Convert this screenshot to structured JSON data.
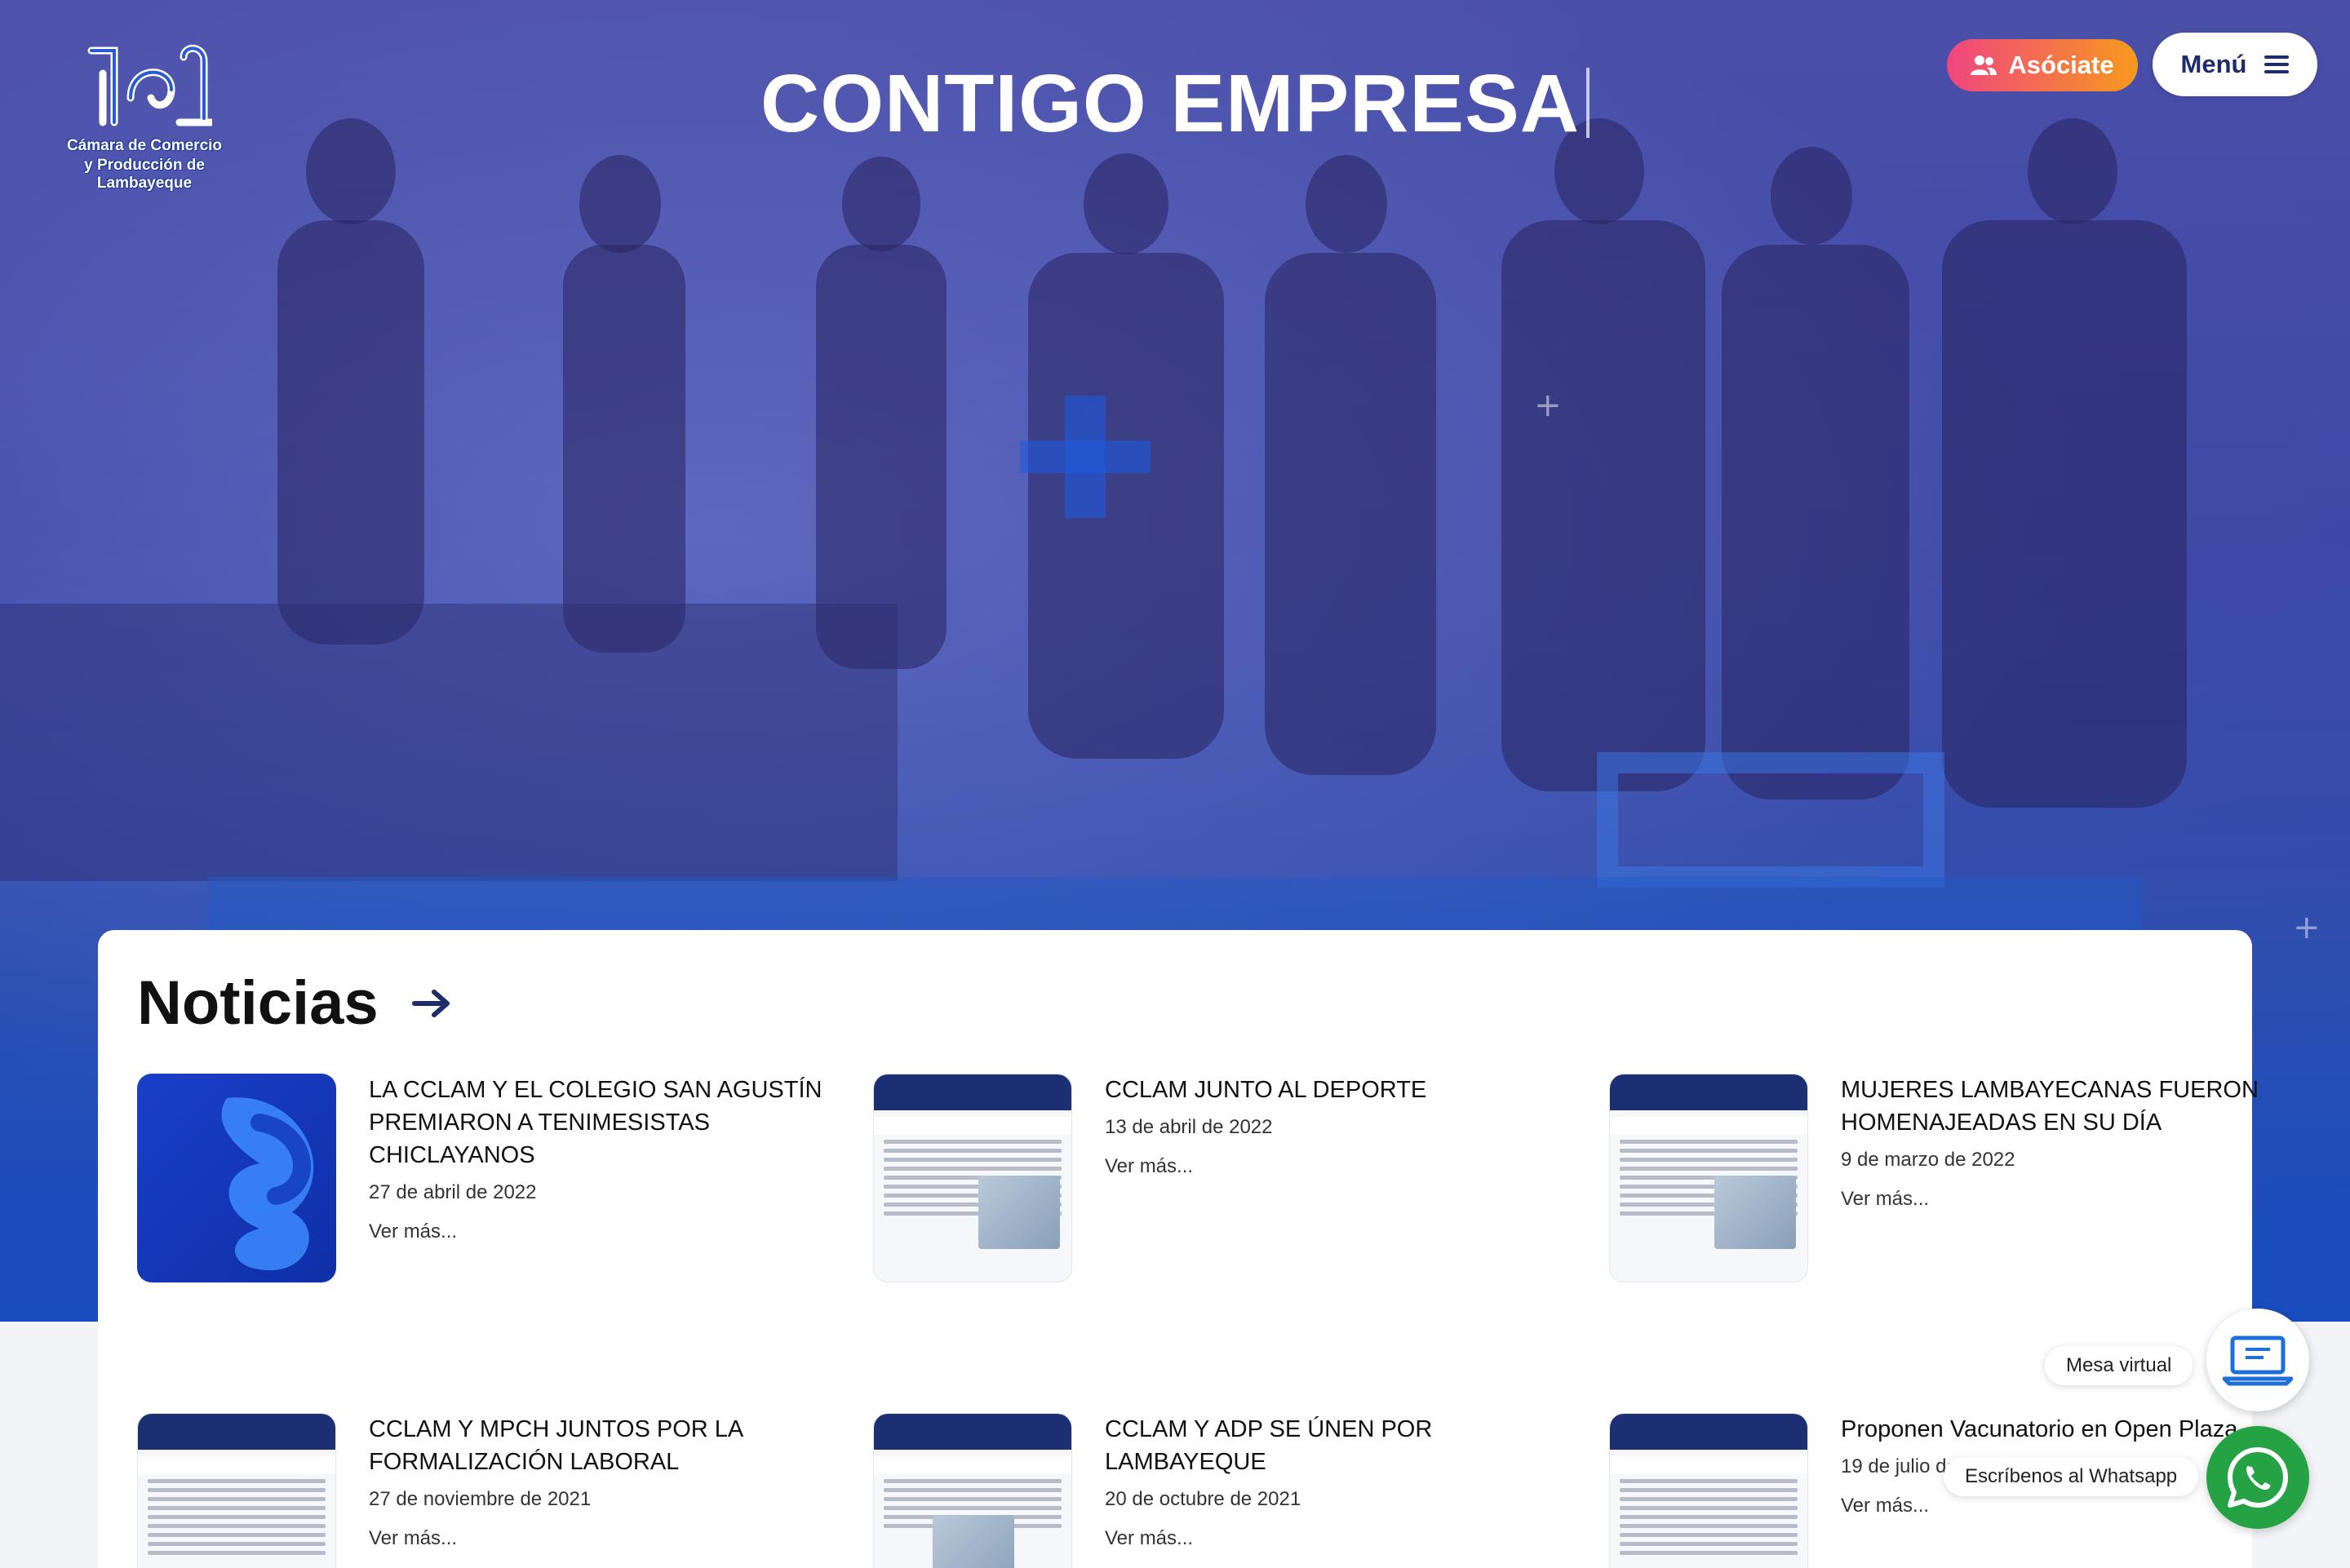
{
  "brand": {
    "name_line1": "Cámara de Comercio",
    "name_line2": "y Producción de Lambayeque"
  },
  "hero": {
    "title": "CONTIGO EMPRESA"
  },
  "header": {
    "asociate_label": "Asóciate",
    "menu_label": "Menú"
  },
  "news": {
    "title": "Noticias",
    "items": [
      {
        "headline": "LA CCLAM Y EL COLEGIO SAN AGUSTÍN PREMIARON A TENIMESISTAS CHICLAYANOS",
        "date": "27 de abril de 2022",
        "more": "Ver más..."
      },
      {
        "headline": "CCLAM JUNTO AL DEPORTE",
        "date": "13 de abril de 2022",
        "more": "Ver más..."
      },
      {
        "headline": "MUJERES LAMBAYECANAS FUERON HOMENAJEADAS EN SU DÍA",
        "date": "9 de marzo de 2022",
        "more": "Ver más..."
      },
      {
        "headline": "CCLAM Y MPCH JUNTOS POR LA FORMALIZACIÓN LABORAL",
        "date": "27 de noviembre de 2021",
        "more": "Ver más..."
      },
      {
        "headline": "CCLAM Y ADP SE ÚNEN POR LAMBAYEQUE",
        "date": "20 de octubre de 2021",
        "more": "Ver más..."
      },
      {
        "headline": "Proponen Vacunatorio en Open Plaza",
        "date": "19 de julio de 2021",
        "more": "Ver más..."
      }
    ]
  },
  "floating": {
    "virtual_desk_label": "Mesa virtual",
    "whatsapp_label": "Escríbenos al Whatsapp"
  },
  "colors": {
    "navy": "#1e2b6d",
    "whatsapp_green": "#25a244",
    "accent_pink": "#f0457f",
    "accent_orange": "#f79a1d"
  },
  "icons": [
    "users-icon",
    "hamburger-icon",
    "arrow-right-icon",
    "laptop-icon",
    "whatsapp-icon"
  ]
}
